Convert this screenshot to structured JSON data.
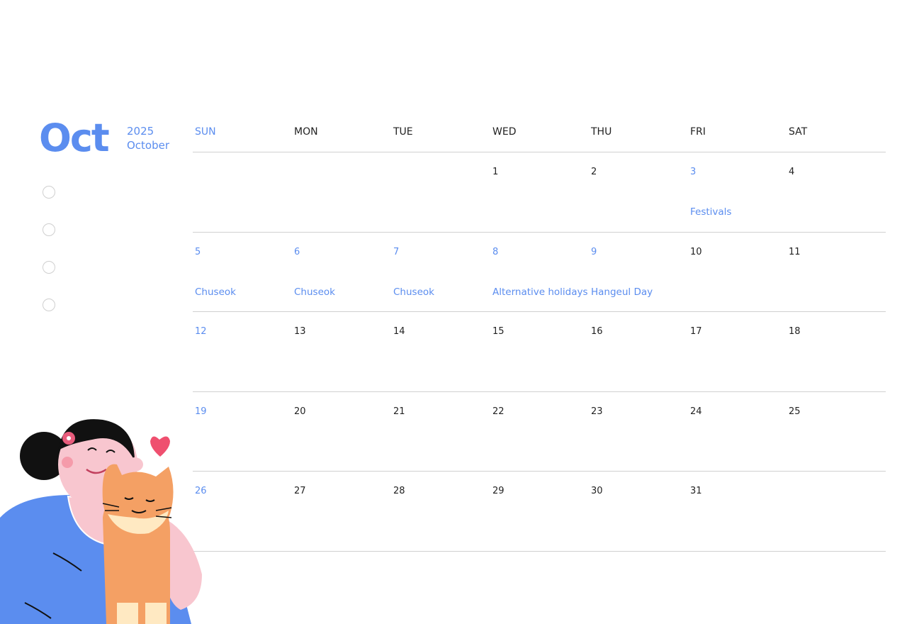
{
  "colors": {
    "accent": "#5B8DEF",
    "text": "#222222",
    "line": "#d0d0d0"
  },
  "header": {
    "month_short": "Oct",
    "year": "2025",
    "month_full": "October"
  },
  "weekdays": [
    {
      "label": "SUN",
      "highlight": true
    },
    {
      "label": "MON",
      "highlight": false
    },
    {
      "label": "TUE",
      "highlight": false
    },
    {
      "label": "WED",
      "highlight": false
    },
    {
      "label": "THU",
      "highlight": false
    },
    {
      "label": "FRI",
      "highlight": false
    },
    {
      "label": "SAT",
      "highlight": false
    }
  ],
  "weeks": [
    [
      {
        "day": "",
        "holiday": false,
        "event": ""
      },
      {
        "day": "",
        "holiday": false,
        "event": ""
      },
      {
        "day": "",
        "holiday": false,
        "event": ""
      },
      {
        "day": "1",
        "holiday": false,
        "event": ""
      },
      {
        "day": "2",
        "holiday": false,
        "event": ""
      },
      {
        "day": "3",
        "holiday": true,
        "event": "Festivals"
      },
      {
        "day": "4",
        "holiday": false,
        "event": ""
      }
    ],
    [
      {
        "day": "5",
        "holiday": true,
        "event": "Chuseok"
      },
      {
        "day": "6",
        "holiday": true,
        "event": "Chuseok"
      },
      {
        "day": "7",
        "holiday": true,
        "event": "Chuseok"
      },
      {
        "day": "8",
        "holiday": true,
        "event": "Alternative holidays"
      },
      {
        "day": "9",
        "holiday": true,
        "event": "Hangeul Day"
      },
      {
        "day": "10",
        "holiday": false,
        "event": ""
      },
      {
        "day": "11",
        "holiday": false,
        "event": ""
      }
    ],
    [
      {
        "day": "12",
        "holiday": true,
        "event": ""
      },
      {
        "day": "13",
        "holiday": false,
        "event": ""
      },
      {
        "day": "14",
        "holiday": false,
        "event": ""
      },
      {
        "day": "15",
        "holiday": false,
        "event": ""
      },
      {
        "day": "16",
        "holiday": false,
        "event": ""
      },
      {
        "day": "17",
        "holiday": false,
        "event": ""
      },
      {
        "day": "18",
        "holiday": false,
        "event": ""
      }
    ],
    [
      {
        "day": "19",
        "holiday": true,
        "event": ""
      },
      {
        "day": "20",
        "holiday": false,
        "event": ""
      },
      {
        "day": "21",
        "holiday": false,
        "event": ""
      },
      {
        "day": "22",
        "holiday": false,
        "event": ""
      },
      {
        "day": "23",
        "holiday": false,
        "event": ""
      },
      {
        "day": "24",
        "holiday": false,
        "event": ""
      },
      {
        "day": "25",
        "holiday": false,
        "event": ""
      }
    ],
    [
      {
        "day": "26",
        "holiday": true,
        "event": ""
      },
      {
        "day": "27",
        "holiday": false,
        "event": ""
      },
      {
        "day": "28",
        "holiday": false,
        "event": ""
      },
      {
        "day": "29",
        "holiday": false,
        "event": ""
      },
      {
        "day": "30",
        "holiday": false,
        "event": ""
      },
      {
        "day": "31",
        "holiday": false,
        "event": ""
      },
      {
        "day": "",
        "holiday": false,
        "event": ""
      }
    ]
  ],
  "todo_count": 4,
  "illustration": {
    "icon": "girl-hugging-cat-illustration"
  }
}
